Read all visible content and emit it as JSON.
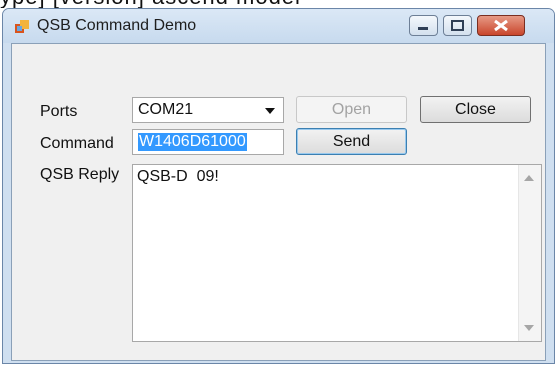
{
  "top_partial_text": "ype] [version] ascend model",
  "window": {
    "title": "QSB Command Demo",
    "icons": {
      "app": "app-form-icon",
      "minimize": "minimize-icon",
      "maximize": "maximize-icon",
      "close": "close-icon"
    }
  },
  "form": {
    "ports_label": "Ports",
    "ports_value": "COM21",
    "open_label": "Open",
    "close_label": "Close",
    "command_label": "Command",
    "command_value": "W1406D61000",
    "send_label": "Send",
    "reply_label": "QSB Reply",
    "reply_text": "QSB-D  09!"
  }
}
